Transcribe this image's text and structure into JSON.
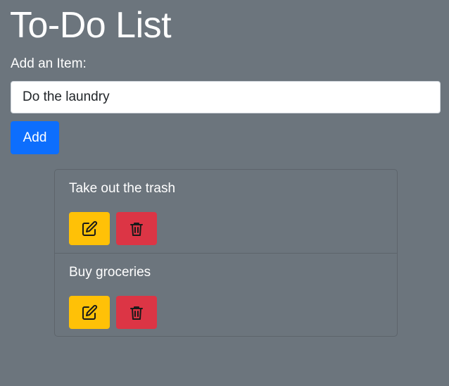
{
  "header": {
    "title": "To-Do List"
  },
  "form": {
    "label": "Add an Item:",
    "input_value": "Do the laundry",
    "add_label": "Add"
  },
  "todos": [
    {
      "text": "Take out the trash",
      "edit_icon": "edit-icon",
      "delete_icon": "trash-icon"
    },
    {
      "text": "Buy groceries",
      "edit_icon": "edit-icon",
      "delete_icon": "trash-icon"
    }
  ],
  "colors": {
    "background": "#6c757d",
    "primary": "#0d6efd",
    "warning": "#ffc107",
    "danger": "#dc3545"
  }
}
